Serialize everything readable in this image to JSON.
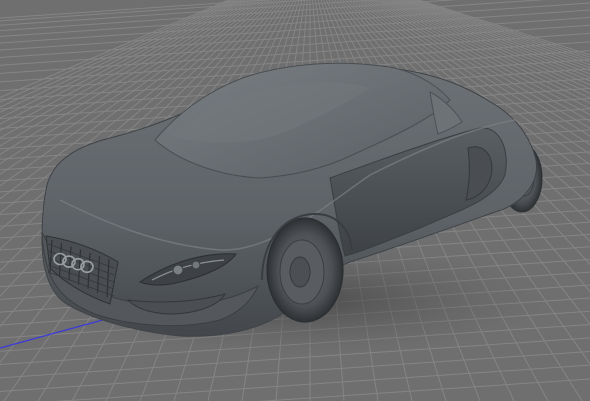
{
  "viewport": {
    "type": "3d-perspective-viewport",
    "background_color": "#6f6f6f",
    "grid_color": "#858585",
    "axis_line_color": "#3a3adc"
  },
  "model": {
    "name": "sports-car",
    "shading": "matte-clay",
    "base_color": "#5f6468",
    "logo_rings": 4
  }
}
